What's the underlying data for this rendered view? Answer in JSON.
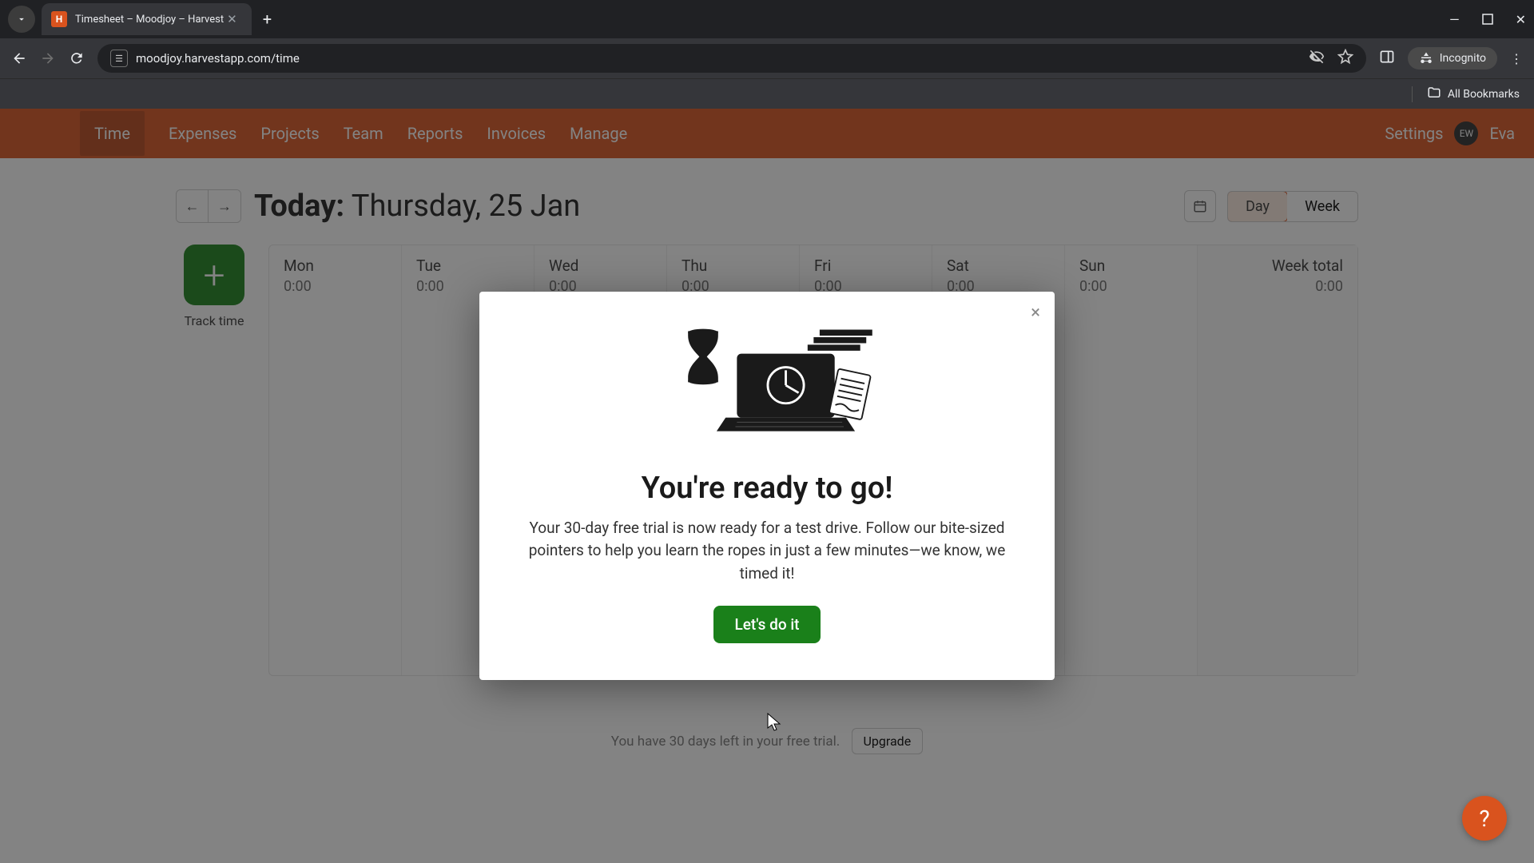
{
  "browser": {
    "tab_title": "Timesheet – Moodjoy – Harvest",
    "url": "moodjoy.harvestapp.com/time",
    "incognito_label": "Incognito",
    "all_bookmarks": "All Bookmarks"
  },
  "nav": {
    "items": [
      "Time",
      "Expenses",
      "Projects",
      "Team",
      "Reports",
      "Invoices",
      "Manage"
    ],
    "settings": "Settings",
    "user_initials": "EW",
    "user_name": "Eva"
  },
  "header": {
    "today_label": "Today:",
    "date_text": "Thursday, 25 Jan",
    "day_label": "Day",
    "week_label": "Week"
  },
  "track": {
    "button_glyph": "+",
    "label": "Track time"
  },
  "week": {
    "days": [
      {
        "name": "Mon",
        "value": "0:00"
      },
      {
        "name": "Tue",
        "value": "0:00"
      },
      {
        "name": "Wed",
        "value": "0:00"
      },
      {
        "name": "Thu",
        "value": "0:00"
      },
      {
        "name": "Fri",
        "value": "0:00"
      },
      {
        "name": "Sat",
        "value": "0:00"
      },
      {
        "name": "Sun",
        "value": "0:00"
      }
    ],
    "total_label": "Week total",
    "total_value": "0:00"
  },
  "trial": {
    "text": "You have 30 days left in your free trial.",
    "upgrade": "Upgrade"
  },
  "modal": {
    "title": "You're ready to go!",
    "body": "Your 30-day free trial is now ready for a test drive. Follow our bite-sized pointers to help you learn the ropes in just a few minutes—we know, we timed it!",
    "cta": "Let's do it",
    "close_glyph": "×"
  },
  "colors": {
    "brand_orange": "#d9531e",
    "brand_green": "#1a801a"
  }
}
